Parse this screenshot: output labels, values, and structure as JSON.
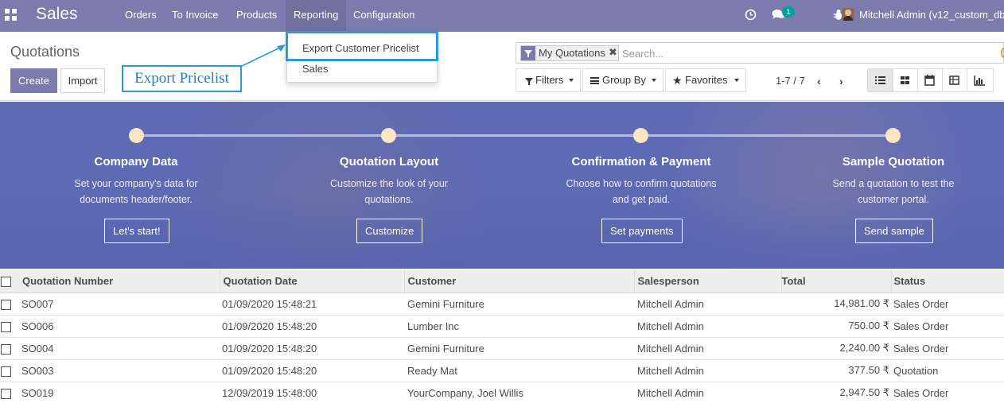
{
  "navbar": {
    "app_name": "Sales",
    "menus": [
      "Orders",
      "To Invoice",
      "Products",
      "Reporting",
      "Configuration"
    ],
    "active_menu": "Reporting",
    "message_count": "1",
    "user": "Mitchell Admin (v12_custom_db"
  },
  "dropdown": {
    "items": [
      "Export Customer Pricelist",
      "Sales"
    ],
    "highlighted": "Export Customer Pricelist"
  },
  "annotation": {
    "callout": "Export Pricelist",
    "color": "#2c9ad8"
  },
  "control_panel": {
    "title": "Quotations",
    "create_label": "Create",
    "import_label": "Import",
    "search": {
      "facet": "My Quotations",
      "placeholder": "Search..."
    },
    "filters_label": "Filters",
    "groupby_label": "Group By",
    "favorites_label": "Favorites",
    "pager": "1-7 / 7",
    "views": [
      "list-view-icon",
      "kanban-view-icon",
      "calendar-view-icon",
      "pivot-view-icon",
      "graph-view-icon"
    ]
  },
  "onboarding": {
    "steps": [
      {
        "title": "Company Data",
        "text": "Set your company's data for documents header/footer.",
        "button": "Let's start!"
      },
      {
        "title": "Quotation Layout",
        "text": "Customize the look of your quotations.",
        "button": "Customize"
      },
      {
        "title": "Confirmation & Payment",
        "text": "Choose how to confirm quotations and get paid.",
        "button": "Set payments"
      },
      {
        "title": "Sample Quotation",
        "text": "Send a quotation to test the customer portal.",
        "button": "Send sample"
      }
    ]
  },
  "table": {
    "columns": [
      "Quotation Number",
      "Quotation Date",
      "Customer",
      "Salesperson",
      "Total",
      "Status"
    ],
    "rows": [
      {
        "number": "SO007",
        "date": "01/09/2020 15:48:21",
        "customer": "Gemini Furniture",
        "salesperson": "Mitchell Admin",
        "total": "14,981.00 ₹",
        "status": "Sales Order"
      },
      {
        "number": "SO006",
        "date": "01/09/2020 15:48:20",
        "customer": "Lumber Inc",
        "salesperson": "Mitchell Admin",
        "total": "750.00 ₹",
        "status": "Sales Order"
      },
      {
        "number": "SO004",
        "date": "01/09/2020 15:48:20",
        "customer": "Gemini Furniture",
        "salesperson": "Mitchell Admin",
        "total": "2,240.00 ₹",
        "status": "Sales Order"
      },
      {
        "number": "SO003",
        "date": "01/09/2020 15:48:20",
        "customer": "Ready Mat",
        "salesperson": "Mitchell Admin",
        "total": "377.50 ₹",
        "status": "Quotation"
      },
      {
        "number": "SO019",
        "date": "12/09/2019 15:48:00",
        "customer": "YourCompany, Joel Willis",
        "salesperson": "Mitchell Admin",
        "total": "2,947.50 ₹",
        "status": "Sales Order"
      }
    ]
  },
  "colors": {
    "brand": "#7c7bad",
    "banner": "#5d6ab4",
    "badge": "#00a09d"
  }
}
